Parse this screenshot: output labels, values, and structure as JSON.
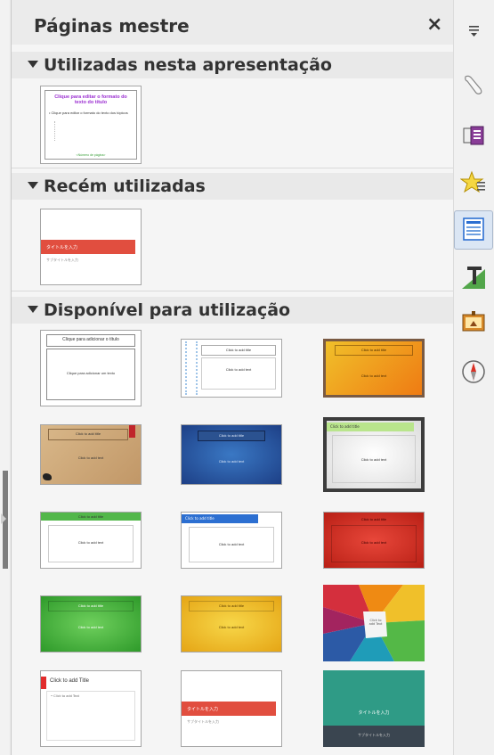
{
  "panel": {
    "title": "Páginas mestre",
    "close_icon": "close-icon",
    "close_glyph": "×"
  },
  "sections": {
    "used": {
      "label": "Utilizadas nesta apresentação"
    },
    "recent": {
      "label": "Recém utilizadas"
    },
    "available": {
      "label": "Disponível para utilização"
    }
  },
  "used_thumb": {
    "title": "Clique para editar o formato do texto do título",
    "body": "• Clique para editar o formato do texto dos tópicos",
    "footer": "<Número de página>"
  },
  "recent_thumb": {
    "title": "タイトルを入力",
    "subtitle": "サブタイトルを入力"
  },
  "templates": [
    {
      "title": "Clique para adicionar o título",
      "body": "Clique para adicionar um texto"
    },
    {
      "title": "Click to add title",
      "body": "Click to add text"
    },
    {
      "title": "Click to add title",
      "body": "Click to add text"
    },
    {
      "title": "Click to add title",
      "body": "Click to add text"
    },
    {
      "title": "Click to add title",
      "body": "Click to add text"
    },
    {
      "title": "Click to add title",
      "body": "Click to add text"
    },
    {
      "title": "Click to add title",
      "body": "Click to add text"
    },
    {
      "title": "Click to add title",
      "body": "Click to add text"
    },
    {
      "title": "Click to add title",
      "body": "Click to add text"
    },
    {
      "title": "Click to add title",
      "body": "Click to add text"
    },
    {
      "title": "Click to add title",
      "body": "Click to add text"
    },
    {
      "title": "",
      "body": "Click to add Text"
    },
    {
      "title": "Click to add Title",
      "body": "• Click to add Text"
    },
    {
      "title": "タイトルを入力",
      "body": "サブタイトルを入力"
    },
    {
      "title": "タイトルを入力",
      "body": "サブタイトルを入力"
    }
  ],
  "sidebar": {
    "items": [
      {
        "icon": "menu-icon"
      },
      {
        "icon": "properties-icon"
      },
      {
        "icon": "slide-transition-icon"
      },
      {
        "icon": "animation-icon"
      },
      {
        "icon": "master-slides-icon",
        "active": true
      },
      {
        "icon": "styles-icon"
      },
      {
        "icon": "gallery-icon"
      },
      {
        "icon": "navigator-icon"
      }
    ]
  },
  "colors": {
    "accent_red": "#e14e3f",
    "accent_teal": "#2f9b86",
    "accent_blue": "#2c5aa6",
    "accent_green": "#52b74a",
    "accent_yellow": "#f0c02a",
    "accent_orange": "#ef8a13"
  }
}
